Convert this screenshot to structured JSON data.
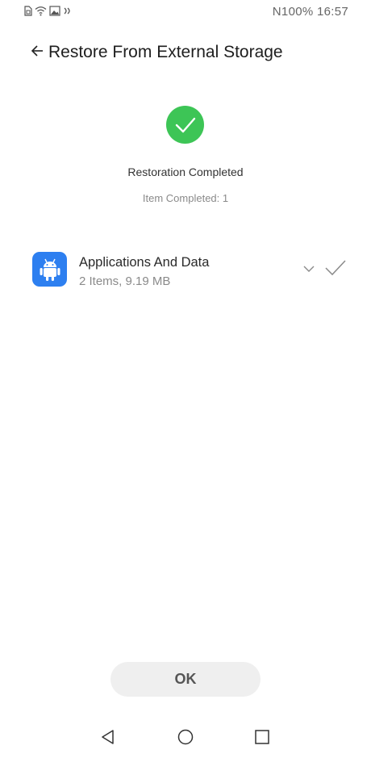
{
  "status_bar": {
    "right_text": "N100% 16:57",
    "icons": [
      "sim-icon",
      "wifi-icon",
      "image-icon",
      "nfc-icon"
    ]
  },
  "header": {
    "back_icon": "back-arrow-icon",
    "title": "Restore From External Storage"
  },
  "result": {
    "icon": "check-circle-icon",
    "icon_color": "#3dc556",
    "title": "Restoration Completed",
    "subtitle": "Item Completed: 1"
  },
  "items": [
    {
      "icon": "android-icon",
      "icon_color": "#2d7ff0",
      "title": "Applications And Data",
      "subtitle": "2 Items, 9.19 MB",
      "expand_icon": "chevron-down-icon",
      "status_icon": "checkmark-icon"
    }
  ],
  "footer": {
    "ok_label": "OK"
  },
  "nav_bar": {
    "icons": [
      "nav-back-icon",
      "nav-home-icon",
      "nav-recents-icon"
    ]
  }
}
